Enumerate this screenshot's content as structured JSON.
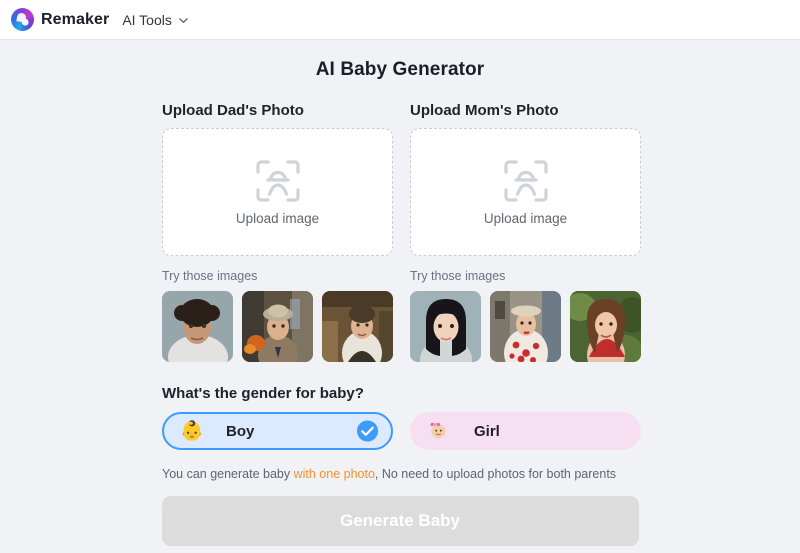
{
  "header": {
    "brand": "Remaker",
    "nav_label": "AI Tools",
    "chevron_icon": "chevron-down-icon",
    "logo_icon": "remaker-logo-icon"
  },
  "page": {
    "title": "AI Baby Generator"
  },
  "upload": {
    "dad": {
      "title": "Upload Dad's Photo",
      "dropzone_label": "Upload image",
      "dropzone_icon": "face-scan-icon",
      "try_label": "Try those images",
      "thumbnails": [
        {
          "name": "dad-sample-1",
          "alt": "Curly dark hair man portrait"
        },
        {
          "name": "dad-sample-2",
          "alt": "Man with flat cap holding flowers"
        },
        {
          "name": "dad-sample-3",
          "alt": "Smiling man in vest in barn"
        }
      ]
    },
    "mom": {
      "title": "Upload Mom's Photo",
      "dropzone_label": "Upload image",
      "dropzone_icon": "face-scan-icon",
      "try_label": "Try those images",
      "thumbnails": [
        {
          "name": "mom-sample-1",
          "alt": "Asian woman long dark hair portrait"
        },
        {
          "name": "mom-sample-2",
          "alt": "Woman in floral red dress with hat"
        },
        {
          "name": "mom-sample-3",
          "alt": "Smiling woman in red top outdoors"
        }
      ]
    }
  },
  "gender": {
    "question": "What's the gender for baby?",
    "options": [
      {
        "label": "Boy",
        "emoji": "👶",
        "selected": true,
        "check_icon": "check-circle-icon"
      },
      {
        "label": "Girl",
        "emoji": "👶",
        "selected": false,
        "check_icon": ""
      }
    ]
  },
  "hint": {
    "before": "You can generate baby ",
    "highlight": "with one photo",
    "after": ", No need to upload photos for both parents"
  },
  "cta": {
    "label": "Generate Baby",
    "disabled": true
  },
  "colors": {
    "accent_blue": "#3d9bfb",
    "boy_bg": "#dbeaff",
    "girl_bg": "#f6dff0",
    "highlight_orange": "#f5912b",
    "cta_disabled": "#dcdcdc",
    "page_bg": "#f1f2f6"
  }
}
